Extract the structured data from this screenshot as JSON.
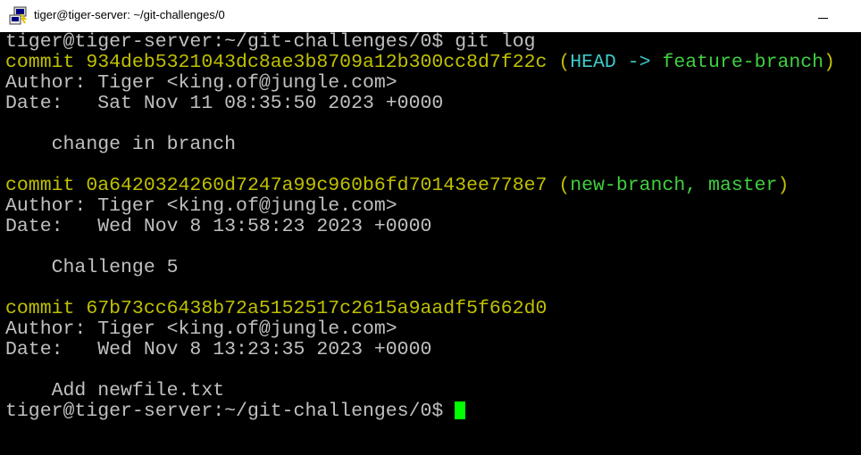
{
  "window": {
    "title": "tiger@tiger-server: ~/git-challenges/0",
    "icon": "putty-icon"
  },
  "terminal": {
    "prompt": "tiger@tiger-server:~/git-challenges/0$",
    "command": "git log",
    "colors": {
      "default": "#c0c0c0",
      "commit": "#c0c000",
      "head": "#40c8c8",
      "branch": "#40d040",
      "cursor": "#00ff00",
      "background": "#000000"
    },
    "commits": [
      {
        "commit_label": "commit 934deb5321043dc8ae3b8709a12b300cc8d7f22c",
        "refs_open": "(",
        "head_ref": "HEAD ->",
        "branch_refs": "feature-branch",
        "refs_close": ")",
        "author": "Author: Tiger <king.of@jungle.com>",
        "date": "Date:   Sat Nov 11 08:35:50 2023 +0000",
        "message": "    change in branch"
      },
      {
        "commit_label": "commit 0a6420324260d7247a99c960b6fd70143ee778e7",
        "refs_open": "(",
        "branch_refs": "new-branch, master",
        "refs_close": ")",
        "author": "Author: Tiger <king.of@jungle.com>",
        "date": "Date:   Wed Nov 8 13:58:23 2023 +0000",
        "message": "    Challenge 5"
      },
      {
        "commit_label": "commit 67b73cc6438b72a5152517c2615a9aadf5f662d0",
        "author": "Author: Tiger <king.of@jungle.com>",
        "date": "Date:   Wed Nov 8 13:23:35 2023 +0000",
        "message": "    Add newfile.txt"
      }
    ]
  }
}
